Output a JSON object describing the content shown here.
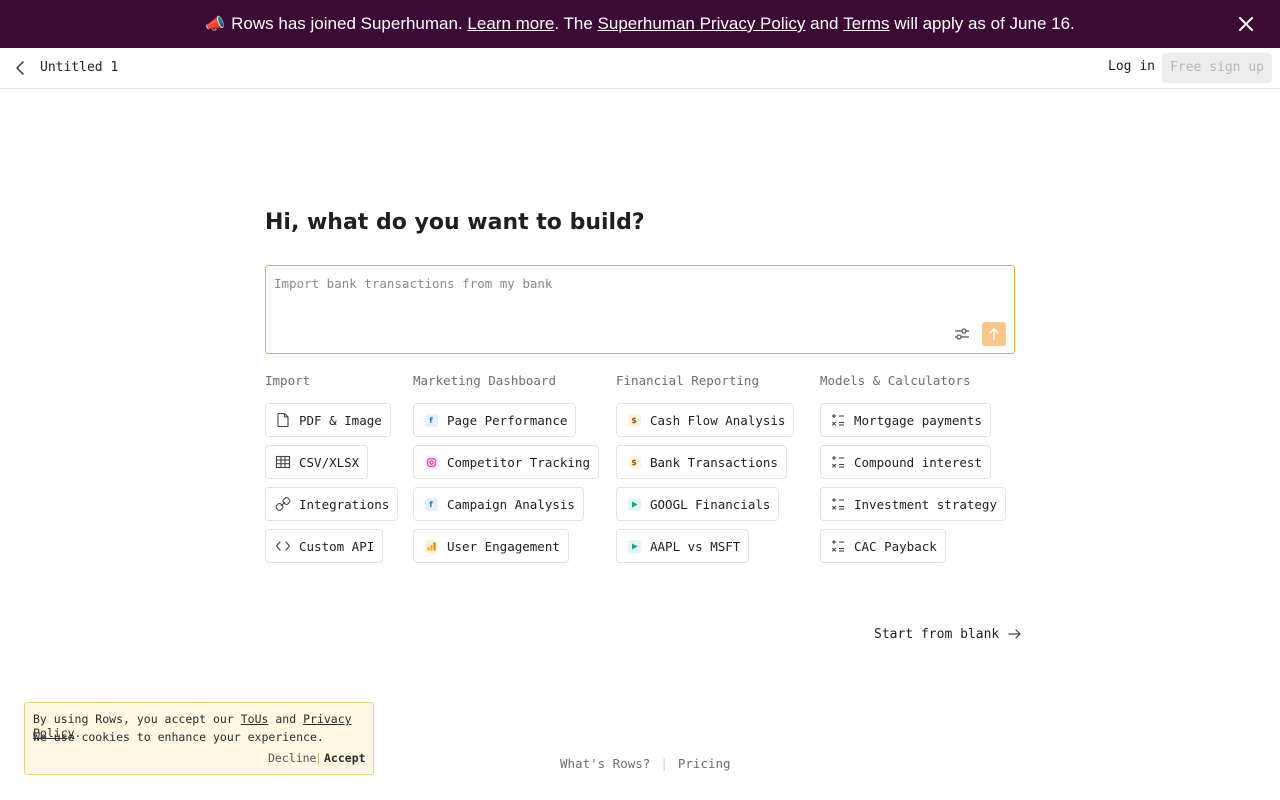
{
  "banner": {
    "icon": "megaphone-icon",
    "text_1": "Rows has joined Superhuman.",
    "link_learn": "Learn more",
    "text_2": ". The",
    "link_privacy": "Superhuman Privacy Policy",
    "text_3": "and",
    "link_terms": "Terms",
    "text_4": "will apply as of June 16.",
    "bg_color": "#3b0a35"
  },
  "header": {
    "doc_title": "Untitled 1",
    "login_label": "Log in",
    "signup_label": "Free sign up"
  },
  "main": {
    "headline": "Hi, what do you want to build?",
    "prompt_placeholder": "Import bank transactions from my bank",
    "accent_color": "#e6a94d"
  },
  "categories": [
    {
      "title": "Import",
      "items": [
        {
          "label": "PDF & Image",
          "icon": "file-icon"
        },
        {
          "label": "CSV/XLSX",
          "icon": "table-icon"
        },
        {
          "label": "Integrations",
          "icon": "link-icon"
        },
        {
          "label": "Custom API",
          "icon": "code-icon"
        }
      ]
    },
    {
      "title": "Marketing Dashboard",
      "items": [
        {
          "label": "Page Performance",
          "icon": "facebook-icon"
        },
        {
          "label": "Competitor Tracking",
          "icon": "instagram-icon"
        },
        {
          "label": "Campaign Analysis",
          "icon": "facebook-icon"
        },
        {
          "label": "User Engagement",
          "icon": "analytics-icon"
        }
      ]
    },
    {
      "title": "Financial Reporting",
      "items": [
        {
          "label": "Cash Flow Analysis",
          "icon": "dollar-icon"
        },
        {
          "label": "Bank Transactions",
          "icon": "dollar-icon"
        },
        {
          "label": "GOOGL Financials",
          "icon": "play-icon"
        },
        {
          "label": "AAPL vs MSFT",
          "icon": "play-icon"
        }
      ]
    },
    {
      "title": "Models & Calculators",
      "items": [
        {
          "label": "Mortgage payments",
          "icon": "calculator-icon"
        },
        {
          "label": "Compound interest",
          "icon": "calculator-icon"
        },
        {
          "label": "Investment strategy",
          "icon": "calculator-icon"
        },
        {
          "label": "CAC Payback",
          "icon": "calculator-icon"
        }
      ]
    }
  ],
  "start_blank_label": "Start from blank",
  "cookie": {
    "text_1": "By using Rows, you accept our",
    "link_tous": "ToUs",
    "text_and": "and",
    "link_privacy": "Privacy Policy",
    "text_period": ".",
    "text_2": "We use cookies to enhance your experience.",
    "decline_label": "Decline",
    "separator": "|",
    "accept_label": "Accept"
  },
  "footer": {
    "whats_rows": "What's Rows?",
    "separator": "|",
    "pricing": "Pricing"
  }
}
